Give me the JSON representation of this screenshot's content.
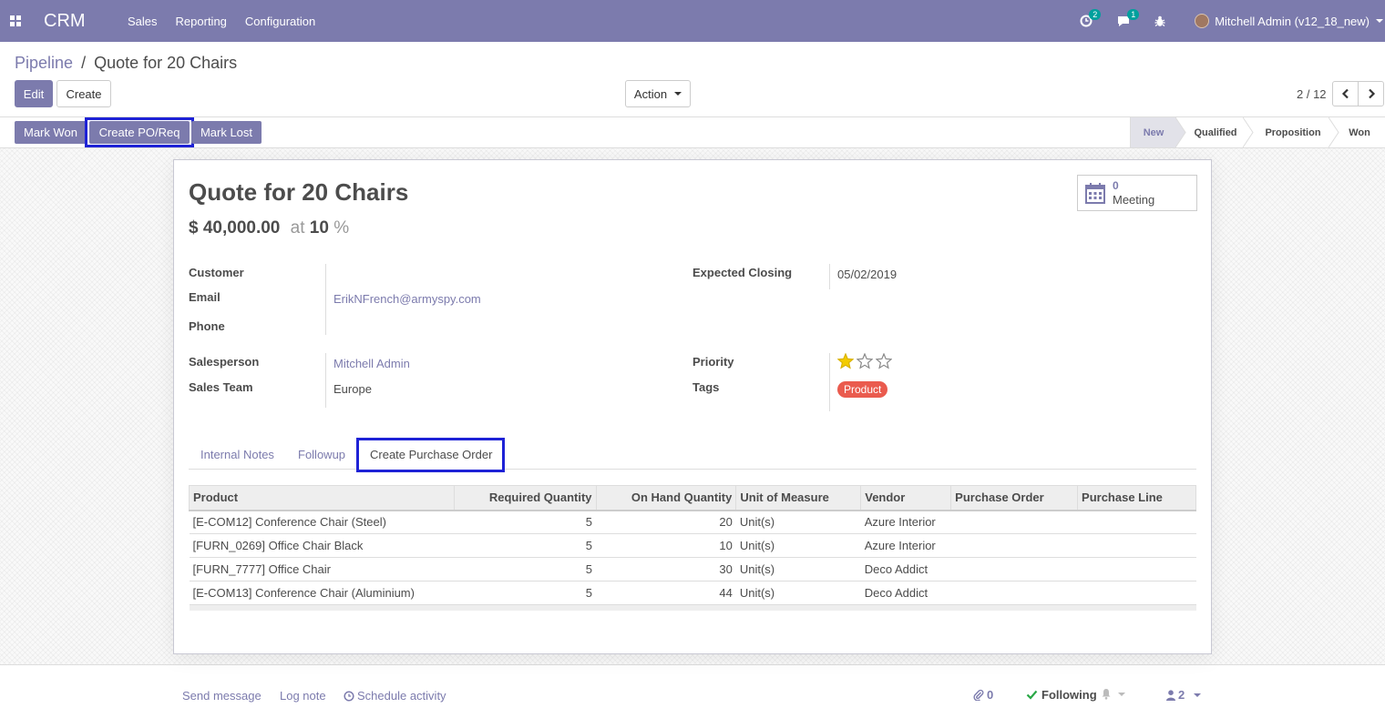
{
  "navbar": {
    "app_name": "CRM",
    "menu": [
      "Sales",
      "Reporting",
      "Configuration"
    ],
    "activity_count": "2",
    "messages_count": "1",
    "user": "Mitchell Admin (v12_18_new)"
  },
  "breadcrumb": {
    "parent": "Pipeline",
    "separator": "/",
    "current": "Quote for 20 Chairs"
  },
  "control_panel": {
    "edit_label": "Edit",
    "create_label": "Create",
    "action_label": "Action",
    "pager": "2 / 12"
  },
  "statusbar": {
    "buttons": {
      "mark_won": "Mark Won",
      "create_po": "Create PO/Req",
      "mark_lost": "Mark Lost"
    },
    "stages": [
      "New",
      "Qualified",
      "Proposition",
      "Won"
    ],
    "active_stage": "New"
  },
  "record": {
    "title": "Quote for 20 Chairs",
    "revenue": "$ 40,000.00",
    "at_label": "at",
    "probability": "10",
    "percent": "%",
    "meeting_count": "0",
    "meeting_label": "Meeting",
    "fields": {
      "customer_label": "Customer",
      "customer_value": "",
      "email_label": "Email",
      "email_value": "ErikNFrench@armyspy.com",
      "phone_label": "Phone",
      "phone_value": "",
      "expected_closing_label": "Expected Closing",
      "expected_closing_value": "05/02/2019",
      "salesperson_label": "Salesperson",
      "salesperson_value": "Mitchell Admin",
      "sales_team_label": "Sales Team",
      "sales_team_value": "Europe",
      "priority_label": "Priority",
      "priority_value": 1,
      "priority_max": 3,
      "tags_label": "Tags",
      "tag": "Product"
    }
  },
  "tabs": [
    "Internal Notes",
    "Followup",
    "Create Purchase Order"
  ],
  "active_tab": "Create Purchase Order",
  "table": {
    "columns": [
      "Product",
      "Required Quantity",
      "On Hand Quantity",
      "Unit of Measure",
      "Vendor",
      "Purchase Order",
      "Purchase Line"
    ],
    "rows": [
      [
        "[E-COM12] Conference Chair (Steel)",
        "5",
        "20",
        "Unit(s)",
        "Azure Interior",
        "",
        ""
      ],
      [
        "[FURN_0269] Office Chair Black",
        "5",
        "10",
        "Unit(s)",
        "Azure Interior",
        "",
        ""
      ],
      [
        "[FURN_7777] Office Chair",
        "5",
        "30",
        "Unit(s)",
        "Deco Addict",
        "",
        ""
      ],
      [
        "[E-COM13] Conference Chair (Aluminium)",
        "5",
        "44",
        "Unit(s)",
        "Deco Addict",
        "",
        ""
      ]
    ]
  },
  "chatter": {
    "send_message": "Send message",
    "log_note": "Log note",
    "schedule_activity": "Schedule activity",
    "attachments": "0",
    "following": "Following",
    "followers": "2"
  },
  "colors": {
    "brand": "#7c7bad",
    "tag": "#ea5b4e",
    "star": "#f3cc00",
    "highlight": "#1e22d6"
  }
}
